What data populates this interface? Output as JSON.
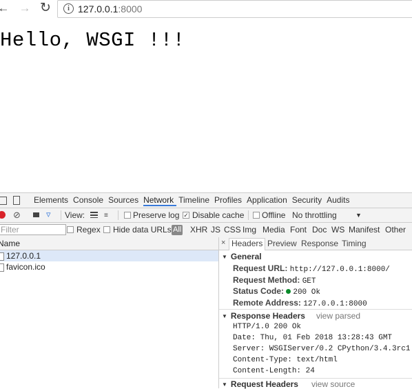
{
  "browser": {
    "url_host": "127.0.0.1",
    "url_port": ":8000",
    "back_icon": "back-arrow-icon",
    "forward_icon": "forward-arrow-icon",
    "reload_icon": "reload-icon",
    "info_icon": "i"
  },
  "page": {
    "body_text": "Hello, WSGI !!!"
  },
  "devtools": {
    "tabs": [
      "Elements",
      "Console",
      "Sources",
      "Network",
      "Timeline",
      "Profiles",
      "Application",
      "Security",
      "Audits"
    ],
    "active_tab": "Network",
    "toolbar": {
      "view_label": "View:",
      "preserve_log": "Preserve log",
      "disable_cache": "Disable cache",
      "offline": "Offline",
      "throttling": "No throttling",
      "dropdown_arrow": "▼"
    },
    "filterbar": {
      "filter_placeholder": "Filter",
      "regex": "Regex",
      "hide_data_urls": "Hide data URLs",
      "all": "All",
      "types": [
        "XHR",
        "JS",
        "CSS",
        "Img",
        "Media",
        "Font",
        "Doc",
        "WS",
        "Manifest",
        "Other"
      ]
    },
    "request_list": {
      "header": "Name",
      "rows": [
        "127.0.0.1",
        "favicon.ico"
      ]
    },
    "details": {
      "close": "×",
      "tabs": [
        "Headers",
        "Preview",
        "Response",
        "Timing"
      ],
      "general": {
        "title": "General",
        "request_url_label": "Request URL:",
        "request_url": "http://127.0.0.1:8000/",
        "request_method_label": "Request Method:",
        "request_method": "GET",
        "status_code_label": "Status Code:",
        "status_code": "200 Ok",
        "remote_address_label": "Remote Address:",
        "remote_address": "127.0.0.1:8000"
      },
      "response_headers": {
        "title": "Response Headers",
        "link": "view parsed",
        "lines": [
          "HTTP/1.0 200 Ok",
          "Date: Thu, 01 Feb 2018 13:28:43 GMT",
          "Server: WSGIServer/0.2 CPython/3.4.3rc1",
          "Content-Type: text/html",
          "Content-Length: 24"
        ]
      },
      "request_headers": {
        "title": "Request Headers",
        "link": "view source"
      }
    }
  }
}
